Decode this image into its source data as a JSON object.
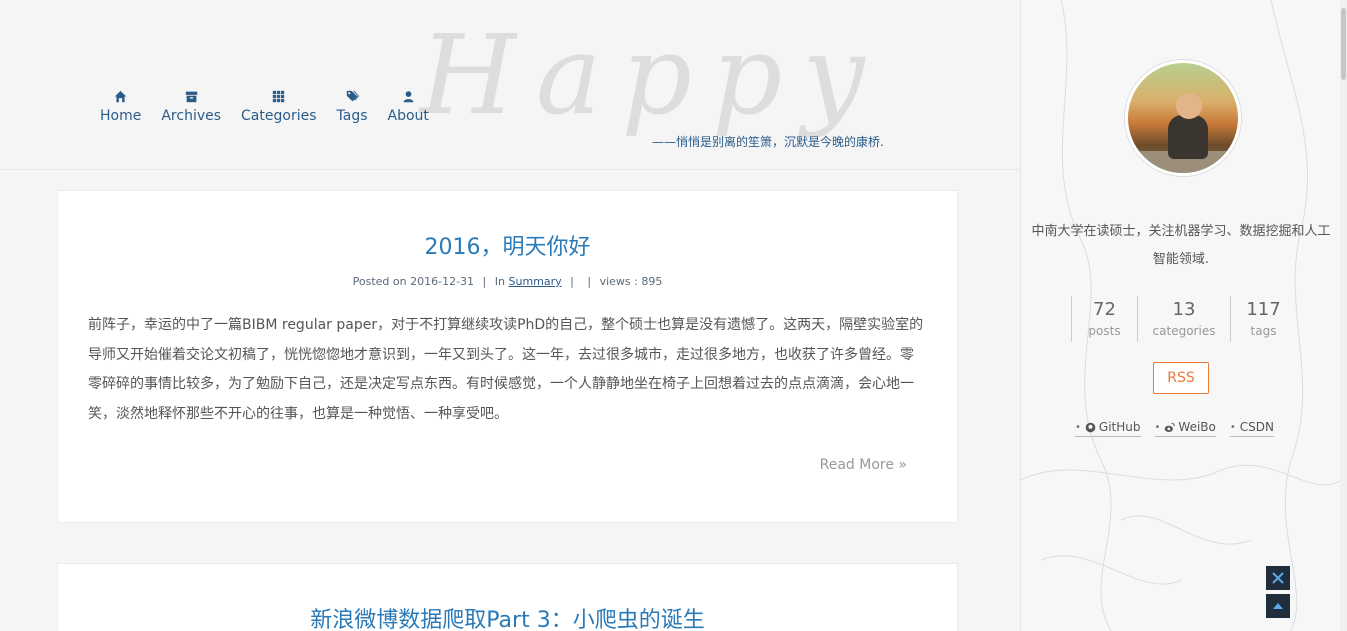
{
  "nav": {
    "items": [
      {
        "label": "Home",
        "icon": "home-icon"
      },
      {
        "label": "Archives",
        "icon": "archive-icon"
      },
      {
        "label": "Categories",
        "icon": "grid-icon"
      },
      {
        "label": "Tags",
        "icon": "tags-icon"
      },
      {
        "label": "About",
        "icon": "user-icon"
      }
    ]
  },
  "header": {
    "watermark": "Happy",
    "motto": "——悄悄是别离的笙箫，沉默是今晚的康桥."
  },
  "posts": [
    {
      "title": "2016，明天你好",
      "posted_label": "Posted on",
      "date": "2016-12-31",
      "in_label": "In",
      "category": "Summary",
      "views_label": "views :",
      "views": "895",
      "excerpt": "前阵子，幸运的中了一篇BIBM regular paper，对于不打算继续攻读PhD的自己，整个硕士也算是没有遗憾了。这两天，隔壁实验室的导师又开始催着交论文初稿了，恍恍惚惚地才意识到，一年又到头了。这一年，去过很多城市，走过很多地方，也收获了许多曾经。零零碎碎的事情比较多，为了勉励下自己，还是决定写点东西。有时候感觉，一个人静静地坐在椅子上回想着过去的点点滴滴，会心地一笑，淡然地释怀那些不开心的往事，也算是一种觉悟、一种享受吧。",
      "read_more": "Read More »"
    },
    {
      "title": "新浪微博数据爬取Part 3：小爬虫的诞生"
    }
  ],
  "sidebar": {
    "bio": "中南大学在读硕士，关注机器学习、数据挖掘和人工智能领域.",
    "stats": [
      {
        "num": "72",
        "label": "posts"
      },
      {
        "num": "13",
        "label": "categories"
      },
      {
        "num": "117",
        "label": "tags"
      }
    ],
    "rss": "RSS",
    "links": [
      {
        "label": "GitHub",
        "icon": "github-icon"
      },
      {
        "label": "WeiBo",
        "icon": "weibo-icon"
      },
      {
        "label": "CSDN",
        "icon": ""
      }
    ]
  },
  "colors": {
    "link": "#2a5c8a",
    "title": "#2a7ab8",
    "rss": "#e87a3a",
    "float_button": "#1f2d3d"
  }
}
